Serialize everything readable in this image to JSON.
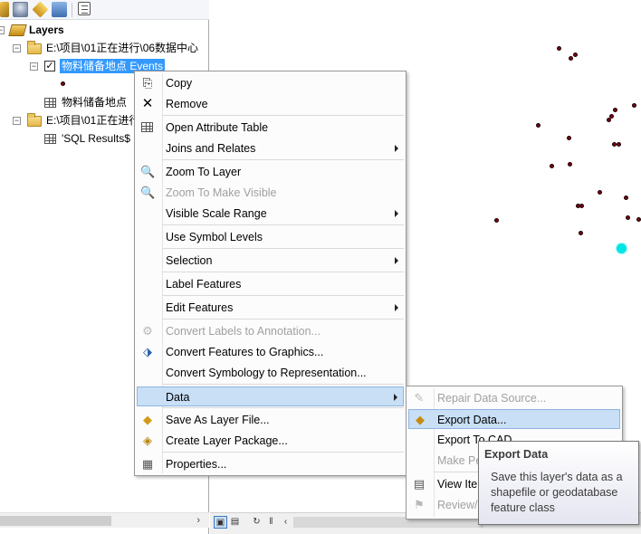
{
  "toc": {
    "layers_title": "Layers",
    "group1_path": "E:\\项目\\01正在进行\\06数据中心",
    "layer_selected": "物料储备地点 Events",
    "table1": "物料储备地点",
    "group2_path": "E:\\项目\\01正在进行",
    "table2": "'SQL Results$"
  },
  "context_menu": {
    "items": [
      {
        "label": "Copy",
        "icon": "copy-icon",
        "enabled": true
      },
      {
        "label": "Remove",
        "icon": "remove-x-icon",
        "enabled": true
      },
      {
        "label": "Open Attribute Table",
        "icon": "table-icon",
        "enabled": true
      },
      {
        "label": "Joins and Relates",
        "icon": "",
        "enabled": true,
        "submenu": true
      },
      {
        "label": "Zoom To Layer",
        "icon": "zoom-to-layer-icon",
        "enabled": true
      },
      {
        "label": "Zoom To Make Visible",
        "icon": "zoom-to-visible-icon",
        "enabled": false
      },
      {
        "label": "Visible Scale Range",
        "icon": "",
        "enabled": true,
        "submenu": true
      },
      {
        "label": "Use Symbol Levels",
        "icon": "",
        "enabled": true
      },
      {
        "label": "Selection",
        "icon": "",
        "enabled": true,
        "submenu": true
      },
      {
        "label": "Label Features",
        "icon": "",
        "enabled": true
      },
      {
        "label": "Edit Features",
        "icon": "",
        "enabled": true,
        "submenu": true
      },
      {
        "label": "Convert Labels to Annotation...",
        "icon": "convert-labels-icon",
        "enabled": false
      },
      {
        "label": "Convert Features to Graphics...",
        "icon": "convert-graphics-icon",
        "enabled": true
      },
      {
        "label": "Convert Symbology to Representation...",
        "icon": "",
        "enabled": true
      },
      {
        "label": "Data",
        "icon": "",
        "enabled": true,
        "submenu": true,
        "highlighted": true
      },
      {
        "label": "Save As Layer File...",
        "icon": "layer-file-icon",
        "enabled": true
      },
      {
        "label": "Create Layer Package...",
        "icon": "layer-package-icon",
        "enabled": true
      },
      {
        "label": "Properties...",
        "icon": "properties-icon",
        "enabled": true
      }
    ]
  },
  "data_submenu": {
    "items": [
      {
        "label": "Repair Data Source...",
        "enabled": false
      },
      {
        "label": "Export Data...",
        "enabled": true,
        "highlighted": true
      },
      {
        "label": "Export To CAD...",
        "enabled": true
      },
      {
        "label": "Make Permanent",
        "enabled": false
      },
      {
        "label": "View Item Description",
        "enabled": true
      },
      {
        "label": "Review/Rematch Addresses",
        "enabled": false
      }
    ]
  },
  "tooltip": {
    "title": "Export Data",
    "body": "Save this layer's data as a shapefile or geodatabase feature class"
  },
  "colors": {
    "point_fill": "#7a0010",
    "selected_point": "#00e5e5",
    "highlight": "#c8dff6",
    "selection_bg": "#3399ff"
  }
}
